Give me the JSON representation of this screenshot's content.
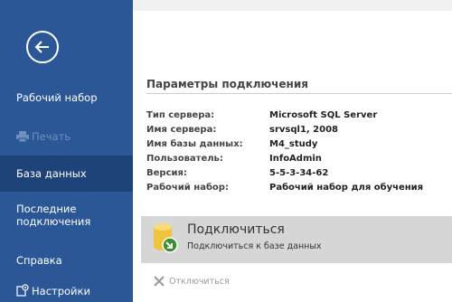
{
  "colors": {
    "sidebar_bg": "#2b5797",
    "sidebar_selected": "#1e4378",
    "sidebar_disabled_text": "#6f8fbf",
    "connect_card_bg": "#d6d6d6"
  },
  "sidebar": {
    "back_icon": "back-arrow-icon",
    "items": [
      {
        "label": "Рабочий набор",
        "state": "normal"
      },
      {
        "label": "Печать",
        "icon": "printer-icon",
        "state": "disabled"
      },
      {
        "label": "База данных",
        "state": "selected"
      },
      {
        "label": "Последние подключения",
        "state": "normal"
      },
      {
        "label": "Справка",
        "state": "normal"
      },
      {
        "label": "Настройки",
        "icon": "settings-icon",
        "state": "normal"
      }
    ]
  },
  "main": {
    "section_title": "Параметры подключения",
    "info": [
      {
        "label": "Тип сервера:",
        "value": "Microsoft SQL Server"
      },
      {
        "label": "Имя сервера:",
        "value": "srvsql1, 2008"
      },
      {
        "label": "Имя базы данных:",
        "value": "M4_study"
      },
      {
        "label": "Пользователь:",
        "value": "InfoAdmin"
      },
      {
        "label": "Версия:",
        "value": "5-5-3-34-62"
      },
      {
        "label": "Рабочий набор:",
        "value": "Рабочий набор для обучения"
      }
    ],
    "connect": {
      "title": "Подключиться",
      "subtitle": "Подключиться к базе данных",
      "icon": "database-connect-icon"
    },
    "disconnect": {
      "label": "Отключиться",
      "icon": "close-icon",
      "state": "disabled"
    }
  }
}
